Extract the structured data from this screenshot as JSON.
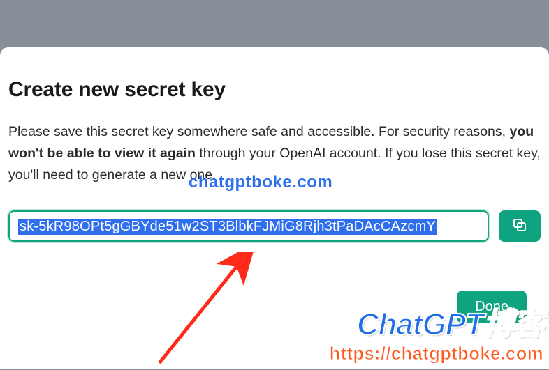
{
  "modal": {
    "title": "Create new secret key",
    "desc_pre": "Please save this secret key somewhere safe and accessible. For security reasons, ",
    "desc_strong": "you won't be able to view it again",
    "desc_post": " through your OpenAI account. If you lose this secret key, you'll need to generate a new one.",
    "key_value": "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",
    "done_label": "Done"
  },
  "watermark": {
    "center": "chatgptboke.com",
    "logo_blue": "ChatGPT",
    "logo_orange": "博客",
    "url": "https://chatgptboke.com"
  },
  "colors": {
    "accent": "#10a37f",
    "selection": "#2f6fed",
    "arrow": "#ff2a1a"
  }
}
